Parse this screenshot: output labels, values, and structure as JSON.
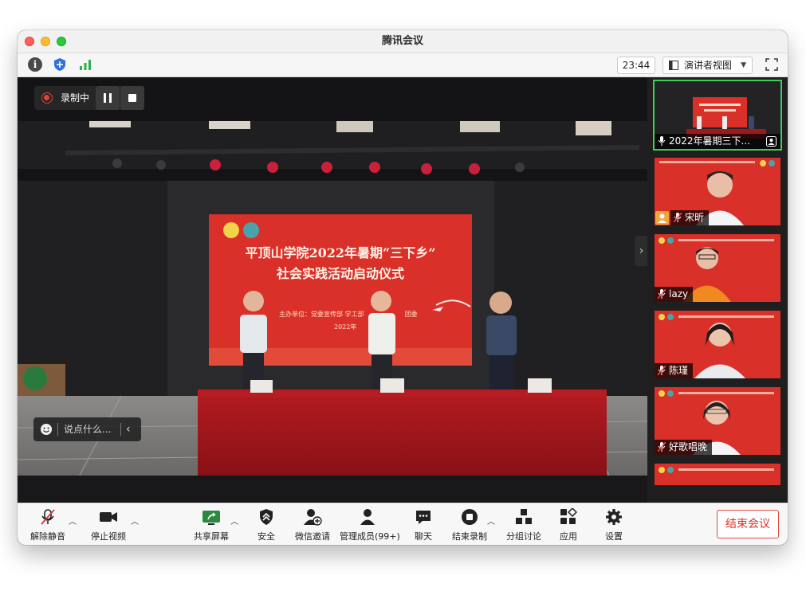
{
  "window": {
    "title": "腾讯会议"
  },
  "infobar": {
    "timer": "23:44",
    "view_mode": "演讲者视图"
  },
  "main": {
    "recording_label": "录制中",
    "chat_placeholder": "说点什么...",
    "banner": {
      "title_line1": "平顶山学院2022年暑期“三下乡”",
      "title_line2": "社会实践活动启动仪式",
      "organizer": "主办单位：党委宣传部 学工部",
      "organizer_tail": "团委",
      "date": "2022年"
    }
  },
  "participants": [
    {
      "name": "2022年暑期三下...",
      "active": true
    },
    {
      "name": "宋昕"
    },
    {
      "name": "lazy"
    },
    {
      "name": "陈瑾"
    },
    {
      "name": "好歌唱晚"
    }
  ],
  "toolbar": {
    "unmute": "解除静音",
    "stop_video": "停止视频",
    "share_screen": "共享屏幕",
    "security": "安全",
    "wechat_invite": "微信邀请",
    "manage_members": "管理成员(99+)",
    "chat": "聊天",
    "end_recording": "结束录制",
    "breakout": "分组讨论",
    "apps": "应用",
    "settings": "设置",
    "end_meeting": "结束会议"
  },
  "colors": {
    "accent_red": "#e0322a",
    "active_green": "#3ccf5a",
    "screen_red": "#d9302a"
  }
}
